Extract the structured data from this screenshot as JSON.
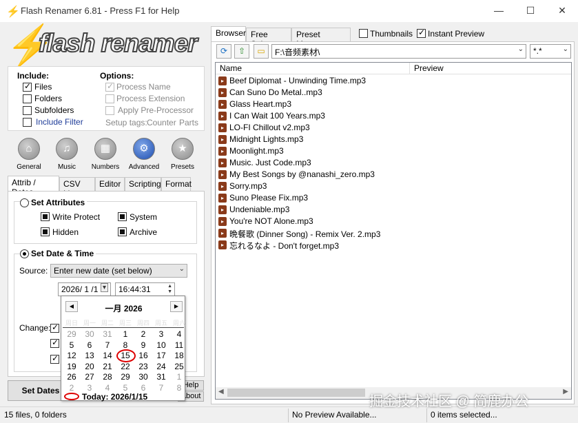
{
  "window": {
    "title": "Flash Renamer 6.81 - Press F1 for Help",
    "minimize": "—",
    "maximize": "☐",
    "close": "✕"
  },
  "logo": {
    "text": "flash renamer",
    "bolt": "⚡"
  },
  "include": {
    "heading": "Include:",
    "files": "Files",
    "folders": "Folders",
    "subfolders": "Subfolders",
    "filter": "Include Filter"
  },
  "options": {
    "heading": "Options:",
    "process_name": "Process Name",
    "process_extension": "Process Extension",
    "pre_processor": "Apply Pre-Processor",
    "setup_tags": "Setup tags:",
    "counter": "Counter",
    "parts": "Parts"
  },
  "toolbar": [
    {
      "label": "General",
      "icon": "⌂"
    },
    {
      "label": "Music",
      "icon": "♫"
    },
    {
      "label": "Numbers",
      "icon": "▦"
    },
    {
      "label": "Advanced",
      "icon": "⚙"
    },
    {
      "label": "Presets",
      "icon": "★"
    }
  ],
  "left_tabs": [
    "Attrib / Dates",
    "CSV List",
    "Editor",
    "Scripting",
    "Format"
  ],
  "attributes": {
    "heading": "Set Attributes",
    "write_protect": "Write Protect",
    "system": "System",
    "hidden": "Hidden",
    "archive": "Archive"
  },
  "datetime": {
    "heading": "Set Date & Time",
    "source_label": "Source:",
    "source_value": "Enter new date (set below)",
    "date_value": "2026/ 1 /1",
    "time_value": "16:44:31",
    "change_label": "Change:"
  },
  "calendar": {
    "month": "一月 2026",
    "weekdays": [
      "周日",
      "周一",
      "周二",
      "周三",
      "周四",
      "周五",
      "周六"
    ],
    "weeks": [
      [
        "29",
        "30",
        "31",
        "1",
        "2",
        "3",
        "4"
      ],
      [
        "5",
        "6",
        "7",
        "8",
        "9",
        "10",
        "11"
      ],
      [
        "12",
        "13",
        "14",
        "15",
        "16",
        "17",
        "18"
      ],
      [
        "19",
        "20",
        "21",
        "22",
        "23",
        "24",
        "25"
      ],
      [
        "26",
        "27",
        "28",
        "29",
        "30",
        "31",
        "1"
      ],
      [
        "2",
        "3",
        "4",
        "5",
        "6",
        "7",
        "8"
      ]
    ],
    "today": "Today: 2026/1/15",
    "selected": "15"
  },
  "buttons": {
    "set_dates": "Set Dates",
    "help": "Help",
    "about": "About"
  },
  "right_tabs": [
    "Browser",
    "Free Select",
    "Preset Manager"
  ],
  "view_options": {
    "thumbnails": "Thumbnails",
    "instant_preview": "Instant Preview"
  },
  "path": "F:\\音频素材\\",
  "file_mask": "*.*",
  "columns": [
    "Name",
    "Preview"
  ],
  "files": [
    "Beef Diplomat - Unwinding Time.mp3",
    "Can Suno Do Metal..mp3",
    "Glass Heart.mp3",
    "I Can Wait 100 Years.mp3",
    "LO-FI Chillout v2.mp3",
    "Midnight Lights.mp3",
    "Moonlight.mp3",
    "Music. Just Code.mp3",
    "My Best Songs by @nanashi_zero.mp3",
    "Sorry.mp3",
    "Suno Please Fix.mp3",
    "Undeniable.mp3",
    "You're NOT Alone.mp3",
    "晩餐歌 (Dinner Song) - Remix Ver. 2.mp3",
    "忘れるなよ - Don't forget.mp3"
  ],
  "status": {
    "count": "15 files, 0 folders",
    "preview": "No Preview Available...",
    "selected": "0 items selected..."
  },
  "watermark": "掘金技术社区 @ 简鹿办公"
}
